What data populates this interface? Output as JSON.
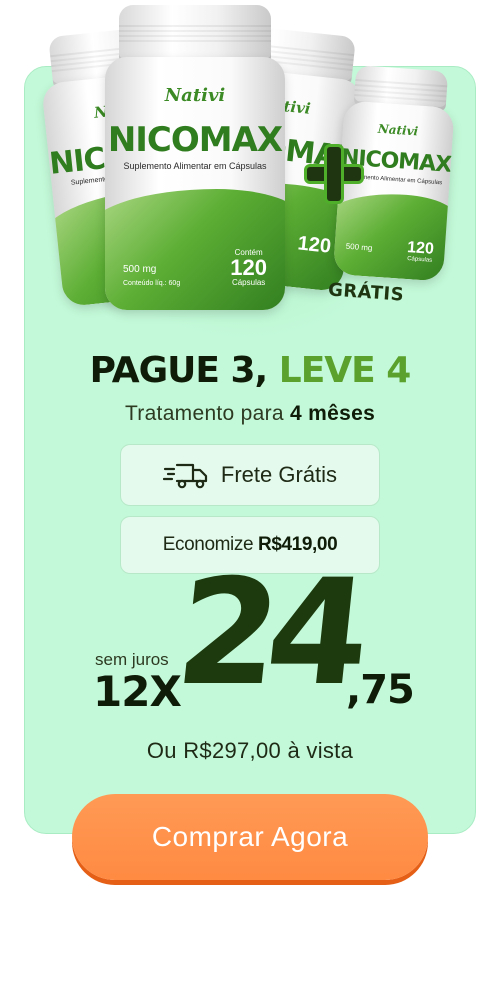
{
  "product": {
    "brand": "Nativi",
    "name": "NICOMAX",
    "subtitle": "Suplemento Alimentar em Cápsulas",
    "dosage": "500 mg",
    "net_weight": "Conteúdo líq.: 60g",
    "count_label": "Contém",
    "count": "120",
    "count_unit": "Cápsulas"
  },
  "bonus": {
    "label": "GRÁTIS"
  },
  "offer": {
    "headline_dark": "PAGUE 3,",
    "headline_green": "LEVE 4",
    "treatment_prefix": "Tratamento para",
    "treatment_bold": "4 mêses"
  },
  "badges": {
    "shipping": "Frete Grátis",
    "savings_prefix": "Economize",
    "savings_value": "R$419,00"
  },
  "price": {
    "installment_note": "sem juros",
    "installments": "12X",
    "integer": "24",
    "cents": ",75",
    "cash": "Ou R$297,00 à vista"
  },
  "cta": {
    "label": "Comprar Agora"
  },
  "colors": {
    "card_bg": "#c3f9d8",
    "accent_green": "#5aa22d",
    "cta_orange": "#ff8a42",
    "dark_text": "#0f1c08"
  }
}
